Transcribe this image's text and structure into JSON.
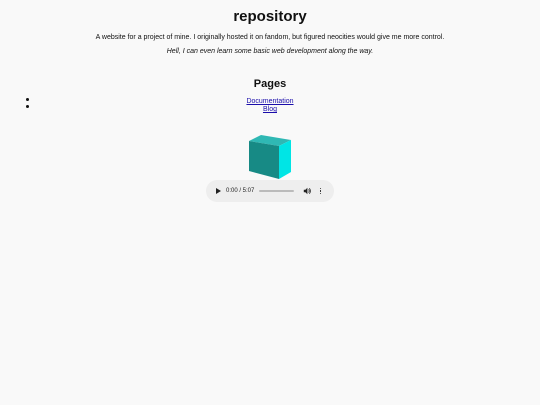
{
  "header": {
    "title": "repository",
    "intro": "A website for a project of mine. I originally hosted it on fandom, but figured neocities would give me more control.",
    "intro_italic": "Hell, I can even learn some basic web development along the way."
  },
  "pages": {
    "heading": "Pages",
    "links": [
      {
        "label": "Documentation"
      },
      {
        "label": "Blog"
      }
    ]
  },
  "cube": {
    "icon": "cube-icon",
    "colors": {
      "front": "#1a8f8a",
      "side": "#00e5e5",
      "top": "#2fb8b4"
    }
  },
  "audio_player": {
    "time": "0:00 / 5:07",
    "progress": 0,
    "icons": [
      "play-icon",
      "volume-icon",
      "more-options-icon"
    ]
  },
  "colors": {
    "background": "#f9f9f9",
    "link": "#1a0dab"
  }
}
